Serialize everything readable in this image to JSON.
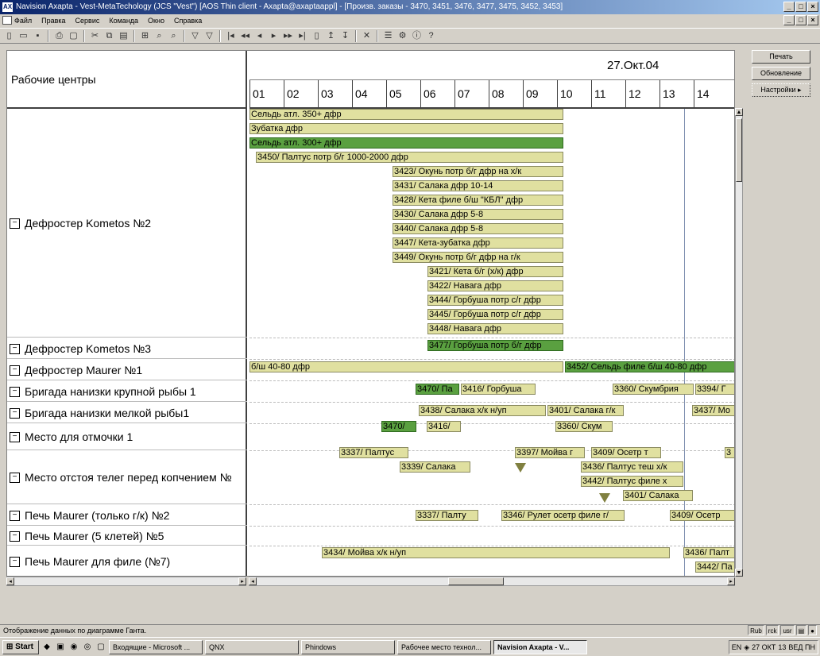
{
  "window": {
    "title": "Navision Axapta - Vest-MetaTechology (JCS \"Vest\") [AOS Thin client - Axapta@axaptaappl] - [Произв. заказы - 3470, 3451, 3476, 3477, 3475, 3452, 3453]",
    "app_icon": "AX"
  },
  "menu": [
    "Файл",
    "Правка",
    "Сервис",
    "Команда",
    "Окно",
    "Справка"
  ],
  "toolbar_icons": [
    "new-icon",
    "open-icon",
    "save-icon",
    "print-icon",
    "preview-icon",
    "cut-icon",
    "copy-icon",
    "paste-icon",
    "filter-icon",
    "find-icon",
    "find-next-icon",
    "filter-selection-icon",
    "remove-filter-icon",
    "first-icon",
    "prev-page-icon",
    "prev-icon",
    "next-icon",
    "next-page-icon",
    "last-icon",
    "doc-icon",
    "sort-asc-icon",
    "sort-desc-icon",
    "delete-icon",
    "properties-icon",
    "settings-icon",
    "info-icon",
    "help-icon"
  ],
  "gantt": {
    "left_header": "Рабочие центры",
    "date": "27.Окт.04",
    "hours": [
      "01",
      "02",
      "03",
      "04",
      "05",
      "06",
      "07",
      "08",
      "09",
      "10",
      "11",
      "12",
      "13",
      "14"
    ],
    "rows": [
      {
        "label": "Дефростер Kometos №2"
      },
      {
        "label": "Дефростер Kometos №3"
      },
      {
        "label": "Дефростер Maurer №1"
      },
      {
        "label": "Бригада нанизки крупной рыбы 1"
      },
      {
        "label": "Бригада нанизки мелкой рыбы1"
      },
      {
        "label": "Место для отмочки 1"
      },
      {
        "label": "Место отстоя телег  перед копчением №"
      },
      {
        "label": "Печь Maurer (только г/к) №2"
      },
      {
        "label": "Печь Maurer (5 клетей) №5"
      },
      {
        "label": "Печь Maurer для филе (№7)"
      }
    ],
    "bars": [
      "Сельдь атл. 350+ дфр",
      "Зубатка  дфр",
      "Сельдь атл. 300+ дфр",
      "3450/ Палтус потр б/г 1000-2000 дфр",
      "3423/ Окунь потр б/г дфр на х/к",
      "3431/ Салака дфр  10-14",
      "3428/ Кета филе б/ш \"КБЛ\" дфр",
      "3430/ Салака  дфр 5-8",
      "3440/ Салака  дфр 5-8",
      "3447/ Кета-зубатка дфр",
      "3449/ Окунь потр б/г дфр на г/к",
      "3421/ Кета  б/г  (х/к) дфр",
      "3422/ Навага дфр",
      "3444/ Горбуша потр с/г дфр",
      "3445/ Горбуша потр с/г дфр",
      "3448/ Навага дфр",
      "3477/ Горбуша  потр б/г дфр",
      "б/ш 40-80 дфр",
      "3452/ Сельдь  филе  б/ш 40-80 дфр",
      "3470/ Па",
      "3416/ Горбуша",
      "3360/ Скумбрия",
      "3394/ Г",
      "3438/ Салака х/к н/уп",
      "3401/ Салака г/к",
      "3437/ Мо",
      "3470/",
      "3416/",
      "3360/ Скум",
      "3337/ Палтус",
      "3397/ Мойва  г",
      "3409/ Осетр   т",
      "3",
      "3339/ Салака",
      "3436/ Палтус   теш х/к",
      "3442/ Палтус   филе х",
      "3401/ Салака",
      "3337/ Палту",
      "3346/ Рулет осетр филе г/",
      "3409/ Осетр   ",
      "3434/ Мойва х/к н/уп",
      "3436/ Палт",
      "3442/ Па"
    ]
  },
  "side_buttons": [
    "Печать",
    "Обновление",
    "Настройки"
  ],
  "status": {
    "text": "Отображение данных по диаграмме Ганта.",
    "cells": [
      "Rub",
      "rck",
      "usr"
    ]
  },
  "taskbar": {
    "start": "Start",
    "tasks": [
      "Входящие - Microsoft ...",
      "QNX",
      "Phindows",
      "Рабочее место технол...",
      "Navision Axapta - V..."
    ],
    "tray": {
      "lang": "EN",
      "date": "27 ОКТ",
      "time": "13",
      "suffix": "ВЕД ПН"
    }
  },
  "colors": {
    "bar": "#e0e0a0",
    "bar_active": "#5aa040",
    "title": "#0a246a"
  }
}
